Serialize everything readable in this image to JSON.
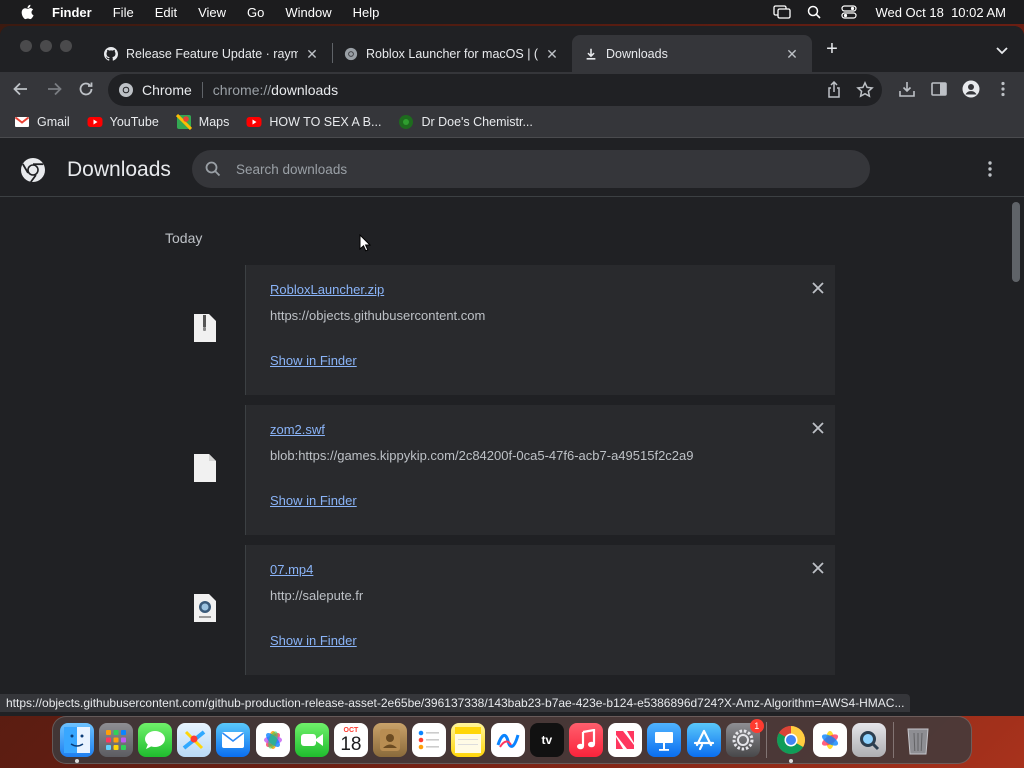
{
  "menubar": {
    "app_name": "Finder",
    "items": [
      "File",
      "Edit",
      "View",
      "Go",
      "Window",
      "Help"
    ],
    "clock": "Wed Oct 18  10:02 AM"
  },
  "tabs": [
    {
      "title": "Release Feature Update · raym",
      "icon": "github-icon"
    },
    {
      "title": "Roblox Launcher for macOS | (",
      "icon": "chrome-icon"
    },
    {
      "title": "Downloads",
      "icon": "download-icon",
      "active": true
    }
  ],
  "omnibox": {
    "site": "Chrome",
    "scheme": "chrome://",
    "path": "downloads"
  },
  "bookmarks": [
    {
      "label": "Gmail",
      "icon": "gmail-icon"
    },
    {
      "label": "YouTube",
      "icon": "youtube-icon"
    },
    {
      "label": "Maps",
      "icon": "maps-icon"
    },
    {
      "label": "HOW TO SEX A B...",
      "icon": "youtube-icon"
    },
    {
      "label": "Dr Doe's Chemistr...",
      "icon": "site-icon"
    }
  ],
  "downloads_page": {
    "title": "Downloads",
    "search_placeholder": "Search downloads",
    "day_label": "Today",
    "items": [
      {
        "filename": "RobloxLauncher.zip",
        "url": "https://objects.githubusercontent.com",
        "action": "Show in Finder",
        "icon": "zip-file-icon"
      },
      {
        "filename": "zom2.swf",
        "url": "blob:https://games.kippykip.com/2c84200f-0ca5-47f6-acb7-a49515f2c2a9",
        "action": "Show in Finder",
        "icon": "blank-file-icon"
      },
      {
        "filename": "07.mp4",
        "url": "http://salepute.fr",
        "action": "Show in Finder",
        "icon": "video-file-icon"
      }
    ]
  },
  "status_url": "https://objects.githubusercontent.com/github-production-release-asset-2e65be/396137338/143bab23-b7ae-423e-b124-e5386896d724?X-Amz-Algorithm=AWS4-HMAC...",
  "dock": {
    "calendar_month": "OCT",
    "calendar_day": "18",
    "settings_badge": "1",
    "tv_label": "tv"
  },
  "colors": {
    "link": "#8ab4f8",
    "background": "#202124",
    "card": "#292a2d"
  }
}
